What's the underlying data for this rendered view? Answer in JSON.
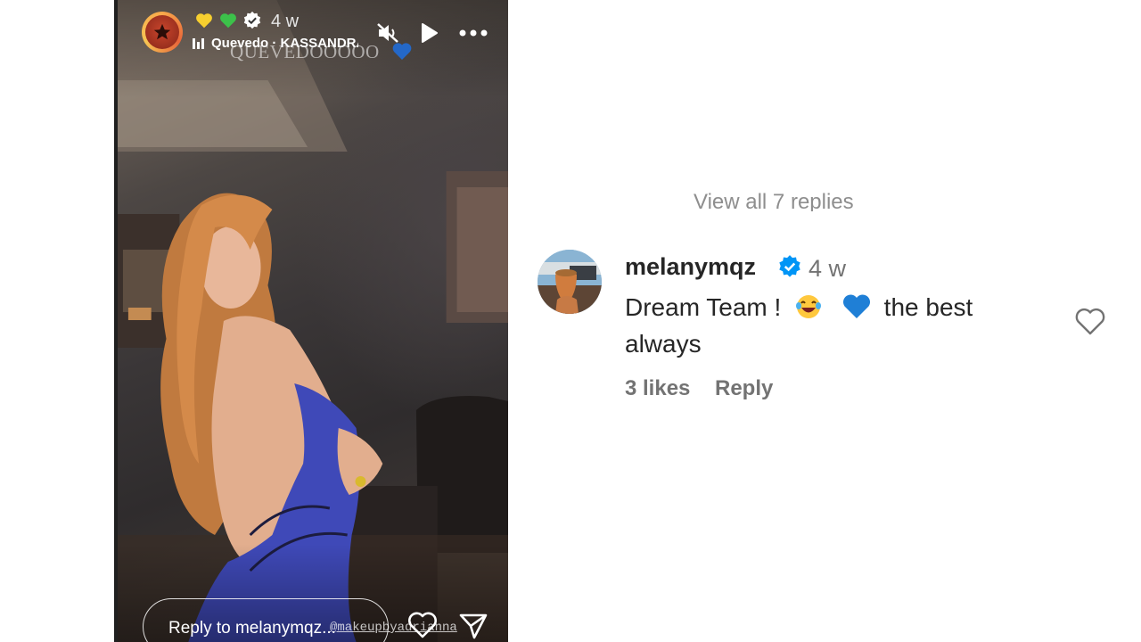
{
  "story": {
    "time": "4 w",
    "music": "Quevedo · KASSANDRA",
    "overlay_text": "QUEVEDOOOOO",
    "reply_placeholder": "Reply to melanymqz...",
    "mention": "@makeupbyadrianna",
    "icons": [
      "yellow-heart-emoji",
      "green-heart-emoji",
      "verified-icon",
      "mute-icon",
      "play-icon",
      "more-icon",
      "blue-heart-emoji",
      "heart-icon",
      "send-icon"
    ]
  },
  "comments": {
    "view_replies": "View all 7 replies",
    "items": [
      {
        "username": "melanymqz",
        "time": "4 w",
        "text_part1": "Dream Team !",
        "text_part2": "the best always",
        "likes": "3 likes",
        "reply_label": "Reply"
      }
    ]
  },
  "colors": {
    "text_primary": "#262626",
    "text_secondary": "#737373",
    "verified_blue": "#0095f6",
    "heart_blue": "#1f7fd6"
  }
}
